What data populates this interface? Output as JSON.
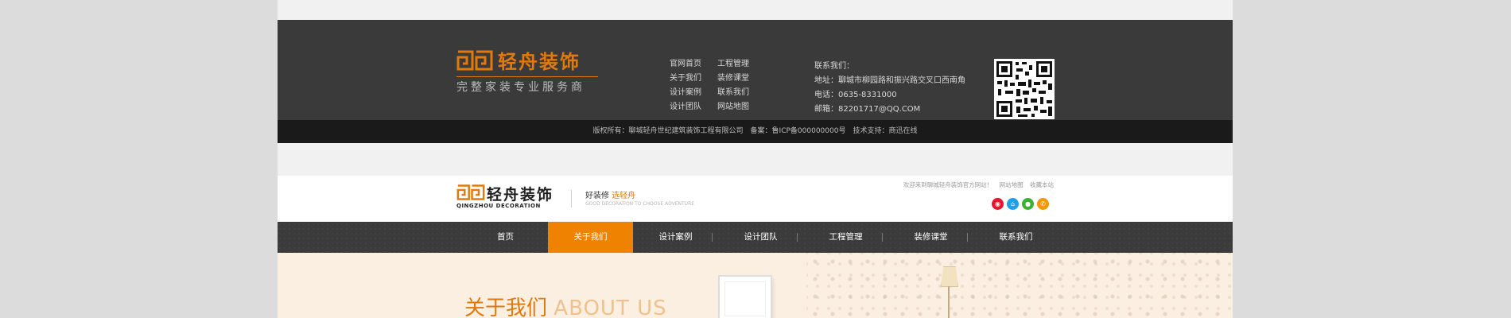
{
  "footer": {
    "brand": "轻舟装饰",
    "slogan": "完整家装专业服务商",
    "nav": [
      {
        "label": "官网首页"
      },
      {
        "label": "工程管理"
      },
      {
        "label": "关于我们"
      },
      {
        "label": "装修课堂"
      },
      {
        "label": "设计案例"
      },
      {
        "label": "联系我们"
      },
      {
        "label": "设计团队"
      },
      {
        "label": "网站地图"
      }
    ],
    "contact": {
      "heading": "联系我们：",
      "address": "地址：聊城市柳园路和振兴路交叉口西南角",
      "phone": "电话：0635-8331000",
      "email": "邮箱：82201717@QQ.COM"
    },
    "copyright": "版权所有：聊城轻舟世纪建筑装饰工程有限公司　备案：鲁ICP备000000000号　技术支持：商迅在线"
  },
  "header": {
    "brand": "轻舟装饰",
    "brand_en": "QINGZHOU DECORATION",
    "tagline_prefix": "好装修",
    "tagline_accent": "选轻舟",
    "tagline_en": "GOOD DECORATION TO CHOOSE ADVENTURE",
    "welcome": "欢迎来到聊城轻舟装饰官方网站！",
    "links": {
      "sitemap": "网站地图",
      "bookmark": "收藏本站"
    },
    "social": [
      {
        "icon": "weibo-icon",
        "glyph": "◉",
        "color": "#e6162d"
      },
      {
        "icon": "home-icon",
        "glyph": "⌂",
        "color": "#1ea0e8"
      },
      {
        "icon": "wechat-icon",
        "glyph": "●",
        "color": "#3cb034"
      },
      {
        "icon": "phone-icon",
        "glyph": "✆",
        "color": "#f39800"
      }
    ]
  },
  "nav": {
    "items": [
      {
        "label": "首页"
      },
      {
        "label": "关于我们",
        "active": true
      },
      {
        "label": "设计案例"
      },
      {
        "label": "设计团队"
      },
      {
        "label": "工程管理"
      },
      {
        "label": "装修课堂"
      },
      {
        "label": "联系我们"
      }
    ]
  },
  "hero": {
    "title_cn": "关于我们",
    "title_en": "ABOUT US"
  },
  "colors": {
    "accent": "#ef8300",
    "footer_dark": "#3a3a3a",
    "footer_darker": "#1a1a1a"
  }
}
